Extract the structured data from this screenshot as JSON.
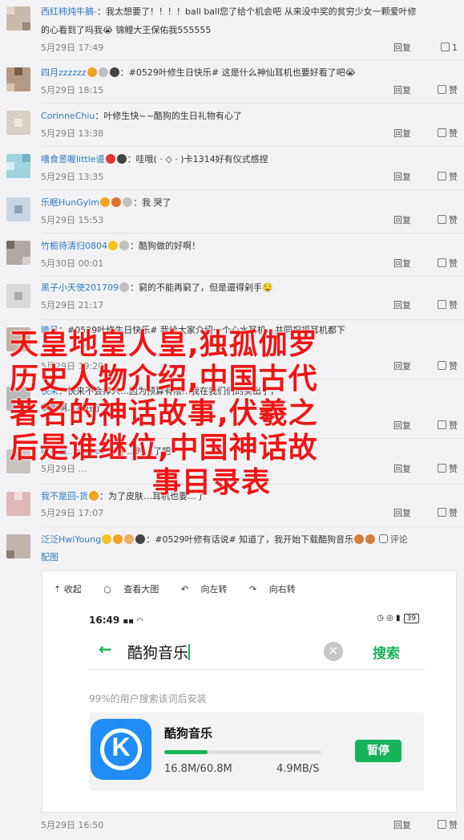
{
  "comments": [
    {
      "user": "西红柿炖牛腩-",
      "text": "：我太想要了！！！！ball  ball您了给个机会吧 从来没中奖的贫穷少女一颗爱叶修",
      "text2": "的心看到了吗我😭 锦鲤大王保佑我555555",
      "time": "5月29日 17:49",
      "reply": "回复",
      "likes": "1"
    },
    {
      "user": "四月zzzzzz",
      "text": "：#0529叶修生日快乐# 这是什么神仙耳机也要好看了吧😭",
      "time": "5月29日 18:15",
      "reply": "回复",
      "likes": "赞"
    },
    {
      "user": "CorinneChiu",
      "text": "：叶修生快~~酷狗的生日礼物有心了",
      "time": "5月29日 13:38",
      "reply": "回复",
      "likes": "赞"
    },
    {
      "user": "嘻食葱喔little谩",
      "text": "：哇哦( · ◇ · )卡1314好有仪式感捏",
      "time": "5月29日 13:35",
      "reply": "回复",
      "likes": "赞"
    },
    {
      "user": "乐眠HunGylm",
      "text": "：我    哭了",
      "time": "5月29日 15:53",
      "reply": "回复",
      "likes": "赞"
    },
    {
      "user": "竹栀待清归0804",
      "text": "：酷狗做的好啊！",
      "time": "5月30日 00:01",
      "reply": "回复",
      "likes": "赞"
    },
    {
      "user": "黑子小天使201709",
      "text": "：窮的不能再窮了，但是還得剁手🤤",
      "time": "5月29日 21:17",
      "reply": "回复",
      "likes": "赞"
    },
    {
      "user": "曦风",
      "text": "：#0529叶修生日快乐# 我给大家介绍一个心水耳机…共同祝福耳机都下",
      "time": "5月29日 19:20",
      "reply": "回复",
      "likes": "赞"
    },
    {
      "user": "快来",
      "text": "：快来不会掉入…因为预算有限…我在我们们的买出了，",
      "text2": "啊啊啊…疯狂了",
      "time": "",
      "reply": "回复",
      "likes": "赞"
    },
    {
      "user": "吐不出…steve",
      "text": "：中午…时…了吧",
      "time": "5月29日 …",
      "reply": "回复",
      "likes": "赞"
    },
    {
      "user": "我不是回-货",
      "text": "：为了皮肤…耳机也要…了",
      "time": "5月29日 17:07",
      "reply": "回复",
      "likes": "赞"
    },
    {
      "user": "泛泛HwiYoung",
      "text": "：#0529叶修有话说# 知道了，我开始下载酷狗音乐",
      "text2": "配图",
      "review": "评论",
      "time": "5月29日 16:50",
      "reply": "回复",
      "likes": "赞"
    }
  ],
  "image_toolbar": {
    "collapse": "收起",
    "view_large": "查看大图",
    "rotate_left": "向左转",
    "rotate_right": "向右转"
  },
  "phone": {
    "clock": "16:49",
    "battery": "39",
    "search_text": "酷狗音乐",
    "search_button": "搜索",
    "hint": "99%的用户搜索该词后安装",
    "app_name": "酷狗音乐",
    "app_logo_letter": "K",
    "download_size": "16.8M/60.8M",
    "download_speed": "4.9MB/S",
    "download_progress": 0.276,
    "pause_button": "暂停"
  },
  "overlay_title": {
    "lines": [
      "天皇地皇人皇,独孤伽罗",
      "历史人物介绍,中国古代",
      "著名的神话故事,伏羲之",
      "后是谁继位,中国神话故",
      "事目录表"
    ]
  },
  "colors": {
    "username": "#2d7bc4",
    "overlay_red": "#f01414",
    "kugou_blue": "#1f8df5",
    "accent_green": "#17b35a"
  }
}
